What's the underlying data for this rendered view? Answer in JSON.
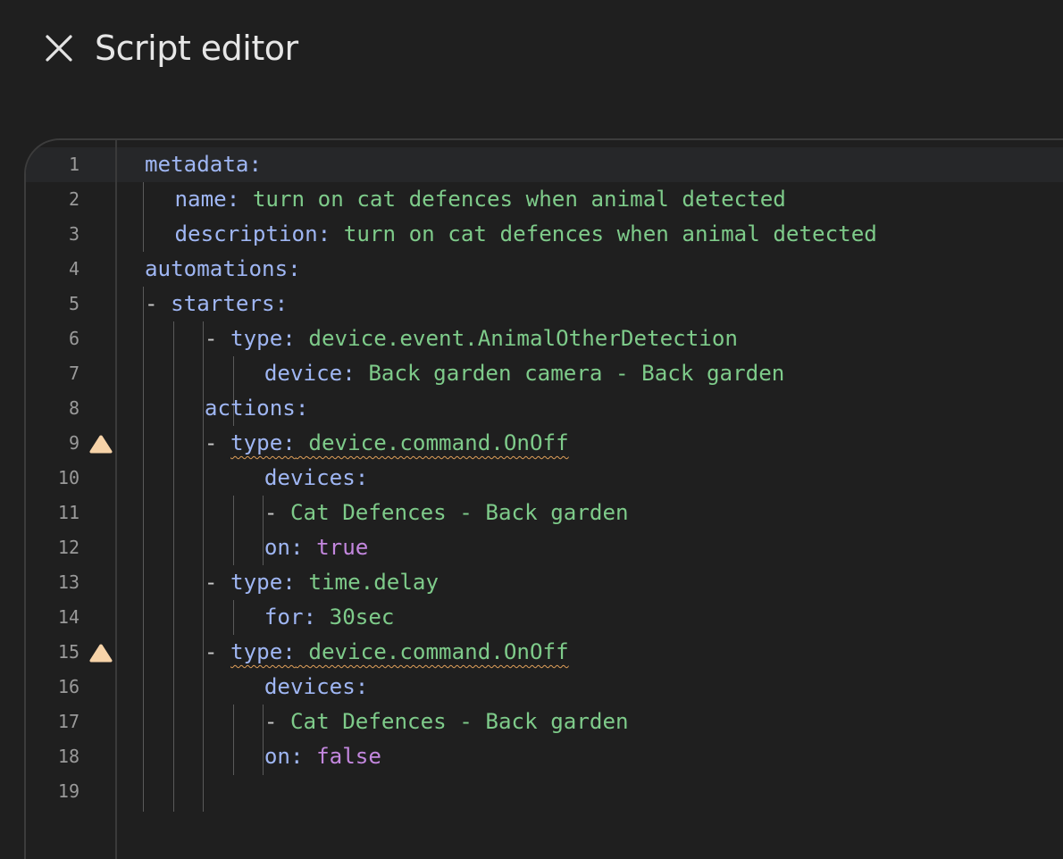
{
  "header": {
    "title": "Script editor",
    "close_icon": "close-icon"
  },
  "editor": {
    "lines": [
      {
        "n": "1",
        "k": "metadata:"
      },
      {
        "n": "2",
        "k": "name:",
        "v": "turn on cat defences when animal detected"
      },
      {
        "n": "3",
        "k": "description:",
        "v": "turn on cat defences when animal detected"
      },
      {
        "n": "4",
        "k": "automations:"
      },
      {
        "n": "5",
        "d": "- ",
        "k": "starters:"
      },
      {
        "n": "6",
        "d": "- ",
        "k": "type:",
        "v": "device.event.AnimalOtherDetection"
      },
      {
        "n": "7",
        "k": "device:",
        "v": "Back garden camera - Back garden"
      },
      {
        "n": "8",
        "k": "actions:"
      },
      {
        "n": "9",
        "d": "- ",
        "k": "type:",
        "v": "device.command.OnOff",
        "warning": "warning-icon"
      },
      {
        "n": "10",
        "k": "devices:"
      },
      {
        "n": "11",
        "d": "- ",
        "v": "Cat Defences - Back garden"
      },
      {
        "n": "12",
        "k": "on:",
        "b": "true"
      },
      {
        "n": "13",
        "d": "- ",
        "k": "type:",
        "v": "time.delay"
      },
      {
        "n": "14",
        "k": "for:",
        "v": "30sec"
      },
      {
        "n": "15",
        "d": "- ",
        "k": "type:",
        "v": "device.command.OnOff",
        "warning": "warning-icon"
      },
      {
        "n": "16",
        "k": "devices:"
      },
      {
        "n": "17",
        "d": "- ",
        "v": "Cat Defences - Back garden"
      },
      {
        "n": "18",
        "k": "on:",
        "b": "false"
      },
      {
        "n": "19"
      }
    ]
  },
  "colors": {
    "background": "#1f1f1f",
    "key": "#9fb6f3",
    "string_value": "#7ecb8a",
    "boolean_value": "#c387de",
    "warning": "#f7d3a8",
    "line_number": "#9a9a9a"
  }
}
